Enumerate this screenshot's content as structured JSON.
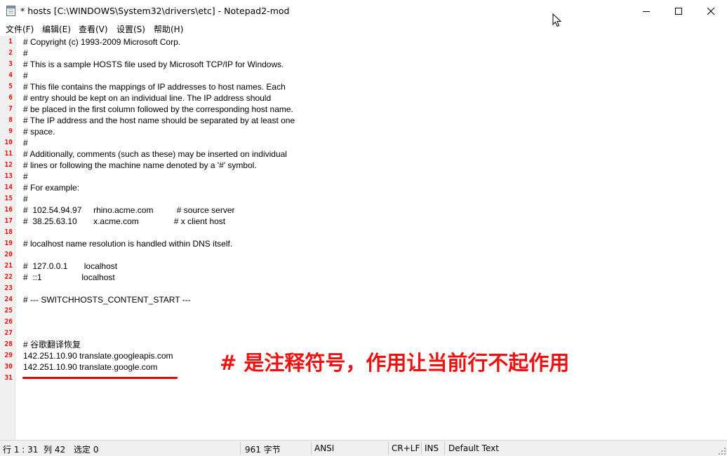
{
  "window": {
    "title": "* hosts [C:\\WINDOWS\\System32\\drivers\\etc] - Notepad2-mod",
    "app_icon": "notepad-icon",
    "controls": {
      "minimize": "minimize-icon",
      "maximize": "maximize-icon",
      "close": "close-icon"
    }
  },
  "menu": {
    "items": [
      "文件(F)",
      "编辑(E)",
      "查看(V)",
      "设置(S)",
      "帮助(H)"
    ]
  },
  "editor": {
    "line_number_color": "#ff0000",
    "lines": [
      "# Copyright (c) 1993-2009 Microsoft Corp.",
      "#",
      "# This is a sample HOSTS file used by Microsoft TCP/IP for Windows.",
      "#",
      "# This file contains the mappings of IP addresses to host names. Each",
      "# entry should be kept on an individual line. The IP address should",
      "# be placed in the first column followed by the corresponding host name.",
      "# The IP address and the host name should be separated by at least one",
      "# space.",
      "#",
      "# Additionally, comments (such as these) may be inserted on individual",
      "# lines or following the machine name denoted by a '#' symbol.",
      "#",
      "# For example:",
      "#",
      "#  102.54.94.97     rhino.acme.com          # source server",
      "#  38.25.63.10       x.acme.com               # x client host",
      "",
      "# localhost name resolution is handled within DNS itself.",
      "",
      "#  127.0.0.1       localhost",
      "#  ::1                 localhost",
      "",
      "# --- SWITCHHOSTS_CONTENT_START ---",
      "",
      "",
      "",
      "# 谷歌翻译恢复",
      "142.251.10.90 translate.googleapis.com",
      "142.251.10.90 translate.google.com",
      ""
    ]
  },
  "annotation": {
    "text": "# 是注释符号，作用让当前行不起作用",
    "color": "#ee1111"
  },
  "statusbar": {
    "position": "行 1 : 31",
    "column": "列 42",
    "selection": "选定 0",
    "size": "961 字节",
    "encoding": "ANSI",
    "line_ending": "CR+LF",
    "insert_mode": "INS",
    "lexer": "Default Text"
  }
}
